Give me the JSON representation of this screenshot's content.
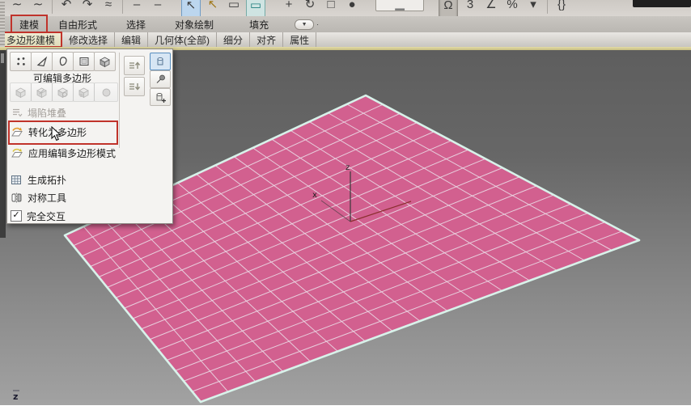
{
  "toolbar": {
    "icons": [
      {
        "n": "mirror-curve-icon",
        "g": "∼",
        "s": ""
      },
      {
        "n": "mirror-curve2-icon",
        "g": "∼",
        "s": ""
      },
      {
        "n": "toolbar-separator",
        "g": "",
        "s": "sep"
      },
      {
        "n": "undo-icon",
        "g": "↶",
        "s": ""
      },
      {
        "n": "redo-icon",
        "g": "↷",
        "s": ""
      },
      {
        "n": "link-wave-icon",
        "g": "≈",
        "s": ""
      },
      {
        "n": "toolbar-separator",
        "g": "",
        "s": "sep"
      },
      {
        "n": "toolbar-slot-icon",
        "g": "‒",
        "s": ""
      },
      {
        "n": "toolbar-slot-icon",
        "g": "‒",
        "s": ""
      },
      {
        "n": "select-object-icon",
        "g": "↖",
        "s": "hl-blue gl"
      },
      {
        "n": "select-by-name-icon",
        "g": "↖",
        "s": "amber"
      },
      {
        "n": "region-rect-icon",
        "g": "▭",
        "s": ""
      },
      {
        "n": "region-crossing-icon",
        "g": "▭",
        "s": "hl-teal"
      },
      {
        "n": "move-icon",
        "g": "+",
        "s": "gl"
      },
      {
        "n": "rotate-icon",
        "g": "↻",
        "s": ""
      },
      {
        "n": "scale-icon",
        "g": "□",
        "s": ""
      },
      {
        "n": "sphere-icon",
        "g": "●",
        "s": ""
      },
      {
        "n": "reference-coordsys-dropdown",
        "g": "▁",
        "s": "wide gl"
      },
      {
        "n": "snap-magnet-icon",
        "g": "Ω",
        "s": "pressed gl"
      },
      {
        "n": "snap-3d-icon",
        "g": "3",
        "s": ""
      },
      {
        "n": "angle-snap-icon",
        "g": "∠",
        "s": ""
      },
      {
        "n": "percent-snap-icon",
        "g": "%",
        "s": ""
      },
      {
        "n": "snap-dropdown-arrow-icon",
        "g": "▾",
        "s": ""
      },
      {
        "n": "toolbar-separator",
        "g": "",
        "s": "sep"
      },
      {
        "n": "named-selection-icon",
        "g": "{}",
        "s": ""
      }
    ]
  },
  "ribbon": {
    "tabs": [
      {
        "label": "建模",
        "annotated": true
      },
      {
        "label": "自由形式",
        "annotated": false
      },
      {
        "label": "选择",
        "annotated": false
      },
      {
        "label": "对象绘制",
        "annotated": false
      },
      {
        "label": "填充",
        "annotated": false
      }
    ],
    "overflow_icon": "▼",
    "overflow_dot": "·",
    "sections": [
      {
        "label": "多边形建模",
        "active": true,
        "annotated": true
      },
      {
        "label": "修改选择",
        "active": false
      },
      {
        "label": "编辑",
        "active": false
      },
      {
        "label": "几何体(全部)",
        "active": false
      },
      {
        "label": "细分",
        "active": false
      },
      {
        "label": "对齐",
        "active": false
      },
      {
        "label": "属性",
        "active": false
      }
    ]
  },
  "panel": {
    "subobject_label": "可编辑多边形",
    "checkmark": "✓",
    "items": [
      {
        "label": "塌陷堆叠",
        "disabled": true
      },
      {
        "label": "转化为多边形",
        "annotated": true
      },
      {
        "label": "应用编辑多边形模式"
      },
      {
        "label": "生成拓扑"
      },
      {
        "label": "对称工具"
      },
      {
        "label": "完全交互",
        "checked": true
      }
    ]
  },
  "viewport": {
    "plane": {
      "corners": {
        "a": [
          452,
          56
        ],
        "b": [
          790,
          235
        ],
        "c": [
          248,
          435
        ],
        "d": [
          80,
          229
        ]
      },
      "divisions": 16,
      "fill": "#d2608f",
      "grid_color": "#ead8e4",
      "border_color": "#d8f2ea"
    },
    "tripod": {
      "z_label": "z",
      "x_label": "x",
      "axis_color": "#3a3a3a",
      "y_axis_color": "#8b2f2f"
    },
    "world_axis_label": "z"
  },
  "annotation": {
    "color": "#c0332b"
  }
}
